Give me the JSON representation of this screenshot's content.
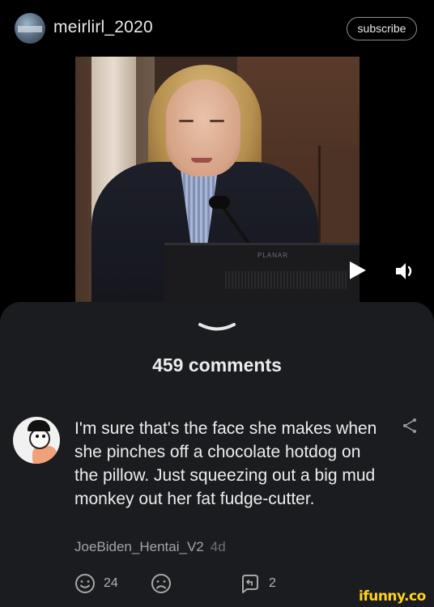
{
  "header": {
    "username": "meirlirl_2020",
    "subscribe_label": "subscribe"
  },
  "media": {
    "monitor_brand": "PLANAR",
    "icons": [
      "play-icon",
      "sound-icon"
    ]
  },
  "comments": {
    "count_label": "459 comments",
    "items": [
      {
        "text": "I'm sure that's the face she makes when she pinches off a chocolate hotdog on the pillow. Just squeezing out a big mud monkey out her fat fudge-cutter.",
        "author": "JoeBiden_Hentai_V2",
        "age": "4d",
        "likes": "24",
        "replies": "2"
      }
    ]
  },
  "watermark": "ifunny.co",
  "colors": {
    "background": "#000000",
    "sheet": "#1b1c20",
    "watermark": "#ffd21f"
  }
}
